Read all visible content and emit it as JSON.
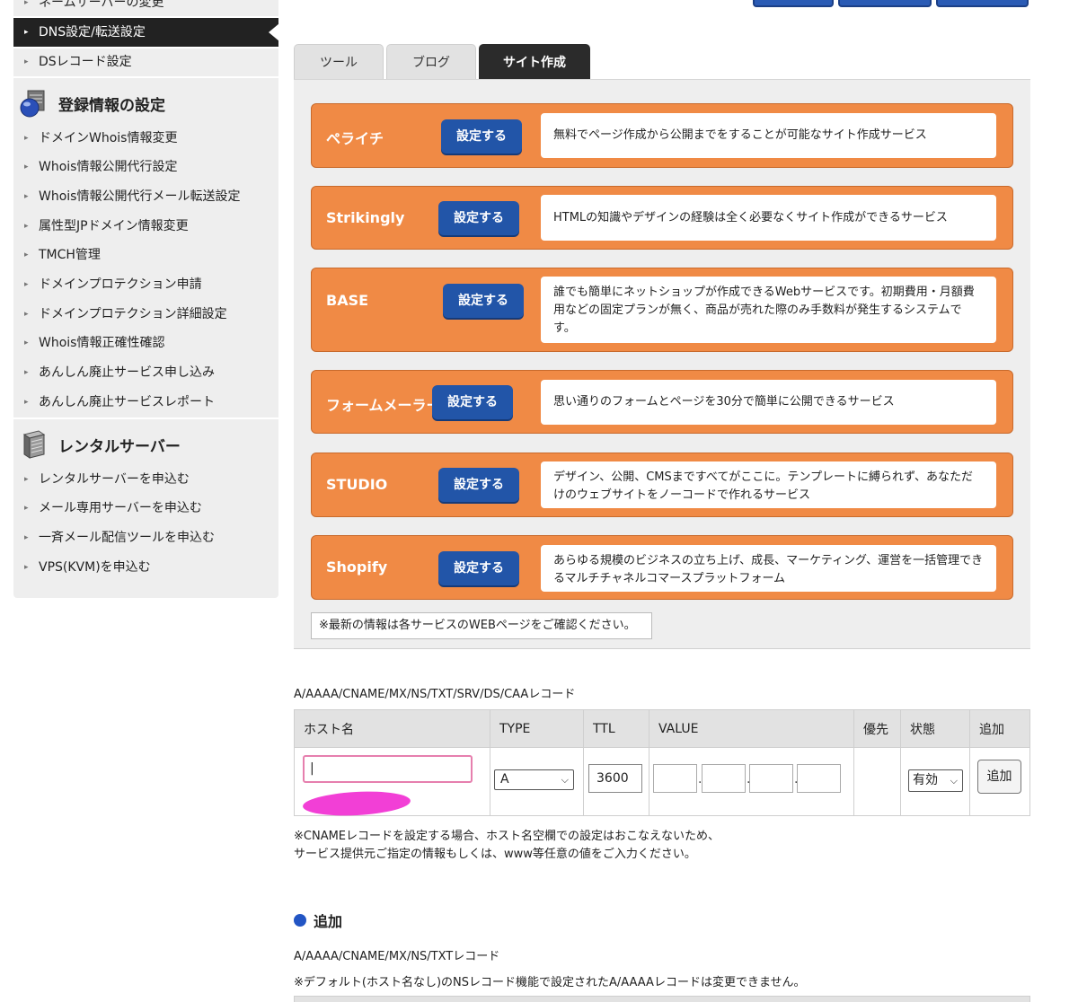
{
  "sidebar": {
    "items_top": [
      {
        "label": "ネームサーバーの変更"
      },
      {
        "label": "DNS設定/転送設定"
      },
      {
        "label": "DSレコード設定"
      }
    ],
    "section_registration": {
      "title": "登録情報の設定",
      "icon": "database-icon"
    },
    "items_registration": [
      {
        "label": "ドメインWhois情報変更"
      },
      {
        "label": "Whois情報公開代行設定"
      },
      {
        "label": "Whois情報公開代行メール転送設定"
      },
      {
        "label": "属性型JPドメイン情報変更"
      },
      {
        "label": "TMCH管理"
      },
      {
        "label": "ドメインプロテクション申請"
      },
      {
        "label": "ドメインプロテクション詳細設定"
      },
      {
        "label": "Whois情報正確性確認"
      },
      {
        "label": "あんしん廃止サービス申し込み"
      },
      {
        "label": "あんしん廃止サービスレポート"
      }
    ],
    "section_rental": {
      "title": "レンタルサーバー",
      "icon": "server-icon"
    },
    "items_rental": [
      {
        "label": "レンタルサーバーを申込む"
      },
      {
        "label": "メール専用サーバーを申込む"
      },
      {
        "label": "一斉メール配信ツールを申込む"
      },
      {
        "label": "VPS(KVM)を申込む"
      }
    ]
  },
  "tabs": [
    {
      "label": "ツール"
    },
    {
      "label": "ブログ"
    },
    {
      "label": "サイト作成"
    }
  ],
  "services": [
    {
      "name": "ペライチ",
      "button": "設定する",
      "desc": "無料でページ作成から公開までをすることが可能なサイト作成サービス"
    },
    {
      "name": "Strikingly",
      "button": "設定する",
      "desc": "HTMLの知識やデザインの経験は全く必要なくサイト作成ができるサービス"
    },
    {
      "name": "BASE",
      "button": "設定する",
      "desc": "誰でも簡単にネットショップが作成できるWebサービスです。初期費用・月額費用などの固定プランが無く、商品が売れた際のみ手数料が発生するシステムです。"
    },
    {
      "name": "フォームメーラー",
      "button": "設定する",
      "desc": "思い通りのフォームとページを30分で簡単に公開できるサービス"
    },
    {
      "name": "STUDIO",
      "button": "設定する",
      "desc": "デザイン、公開、CMSまですべてがここに。テンプレートに縛られず、あなただけのウェブサイトをノーコードで作れるサービス"
    },
    {
      "name": "Shopify",
      "button": "設定する",
      "desc": "あらゆる規模のビジネスの立ち上げ、成長、マーケティング、運営を一括管理できるマルチチャネルコマースプラットフォーム"
    }
  ],
  "notice": "※最新の情報は各サービスのWEBページをご確認ください。",
  "records": {
    "title": "A/AAAA/CNAME/MX/NS/TXT/SRV/DS/CAAレコード",
    "headers": [
      "ホスト名",
      "TYPE",
      "TTL",
      "VALUE",
      "優先",
      "状態",
      "追加"
    ],
    "host_value": "|",
    "type_value": "A",
    "ttl_value": "3600",
    "state_value": "有効",
    "add_button": "追加",
    "note_line1": "※CNAMEレコードを設定する場合、ホスト名空欄での設定はおこなえないため、",
    "note_line2": "サービス提供元ご指定の情報もしくは、www等任意の値をご入力ください。"
  },
  "add_section": {
    "title": "追加",
    "subtitle": "A/AAAA/CNAME/MX/NS/TXTレコード",
    "note": "※デフォルト(ホスト名なし)のNSレコード機能で設定されたA/AAAAレコードは変更できません。"
  },
  "colors": {
    "service_orange": "#f08a45",
    "button_blue": "#2255a8",
    "active_nav": "#222222",
    "redaction": "#f23fd6"
  }
}
